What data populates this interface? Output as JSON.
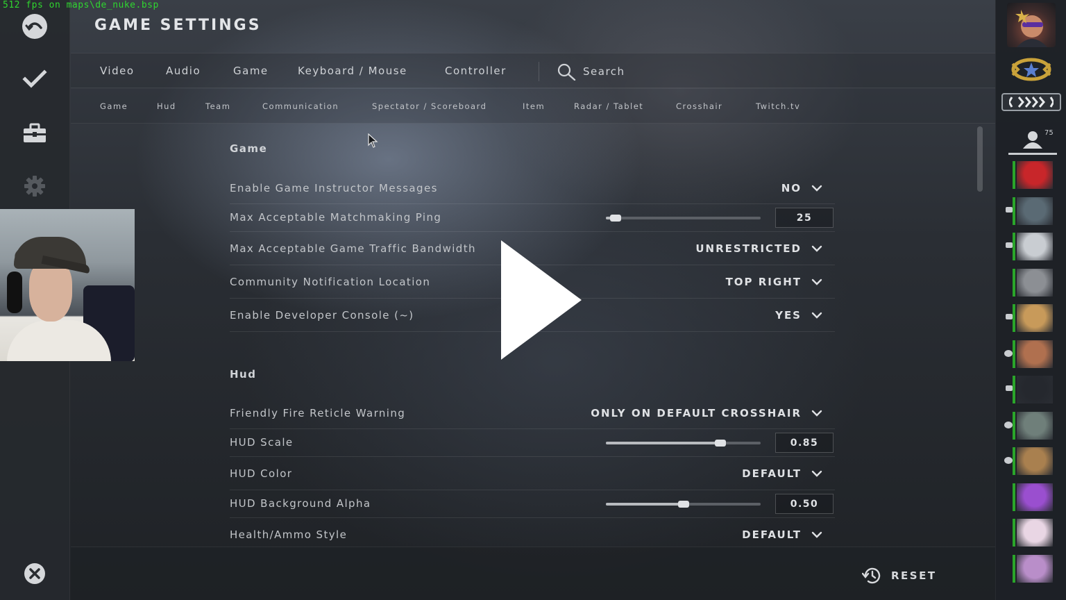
{
  "overlay": {
    "fps_text": "512 fps on maps\\de_nuke.bsp"
  },
  "header": {
    "title": "GAME SETTINGS"
  },
  "main_tabs": {
    "items": [
      "Video",
      "Audio",
      "Game",
      "Keyboard / Mouse",
      "Controller"
    ],
    "active": "Game",
    "search_label": "Search"
  },
  "sub_tabs": {
    "items": [
      "Game",
      "Hud",
      "Team",
      "Communication",
      "Spectator / Scoreboard",
      "Item",
      "Radar / Tablet",
      "Crosshair",
      "Twitch.tv"
    ],
    "active": "Game"
  },
  "sections": {
    "game": {
      "title": "Game",
      "rows": [
        {
          "label": "Enable Game Instructor Messages",
          "type": "dropdown",
          "value": "NO"
        },
        {
          "label": "Max Acceptable Matchmaking Ping",
          "type": "slider",
          "value": "25",
          "level": 0.03
        },
        {
          "label": "Max Acceptable Game Traffic Bandwidth",
          "type": "dropdown",
          "value": "UNRESTRICTED"
        },
        {
          "label": "Community Notification Location",
          "type": "dropdown",
          "value": "TOP RIGHT"
        },
        {
          "label": "Enable Developer Console (~)",
          "type": "dropdown",
          "value": "YES"
        }
      ]
    },
    "hud": {
      "title": "Hud",
      "rows": [
        {
          "label": "Friendly Fire Reticle Warning",
          "type": "dropdown",
          "value": "ONLY ON DEFAULT CROSSHAIR"
        },
        {
          "label": "HUD Scale",
          "type": "slider",
          "value": "0.85",
          "level": 0.76
        },
        {
          "label": "HUD Color",
          "type": "dropdown",
          "value": "DEFAULT"
        },
        {
          "label": "HUD Background Alpha",
          "type": "slider",
          "value": "0.50",
          "level": 0.5
        },
        {
          "label": "Health/Ammo Style",
          "type": "dropdown",
          "value": "DEFAULT"
        }
      ]
    }
  },
  "footer": {
    "reset_label": "RESET"
  },
  "right_rail": {
    "friends_count": "75",
    "friends": [
      {
        "color": "#c8262a",
        "status": "online"
      },
      {
        "color": "#5a6a74",
        "status": "in-game"
      },
      {
        "color": "#c9cdd2",
        "status": "in-game"
      },
      {
        "color": "#8c8f94",
        "status": "online"
      },
      {
        "color": "#c89a5a",
        "status": "in-game"
      },
      {
        "color": "#b0704f",
        "status": "spectating"
      },
      {
        "color": "#25282e",
        "status": "in-game"
      },
      {
        "color": "#6f7f7a",
        "status": "spectating"
      },
      {
        "color": "#a9804f",
        "status": "in-game-spectating"
      },
      {
        "color": "#9a4fcf",
        "status": "online"
      },
      {
        "color": "#e9d6e4",
        "status": "online"
      },
      {
        "color": "#b98ec9",
        "status": "online"
      }
    ]
  },
  "colors": {
    "accent_online": "#2aa52a",
    "fps_text": "#2fd62f"
  }
}
